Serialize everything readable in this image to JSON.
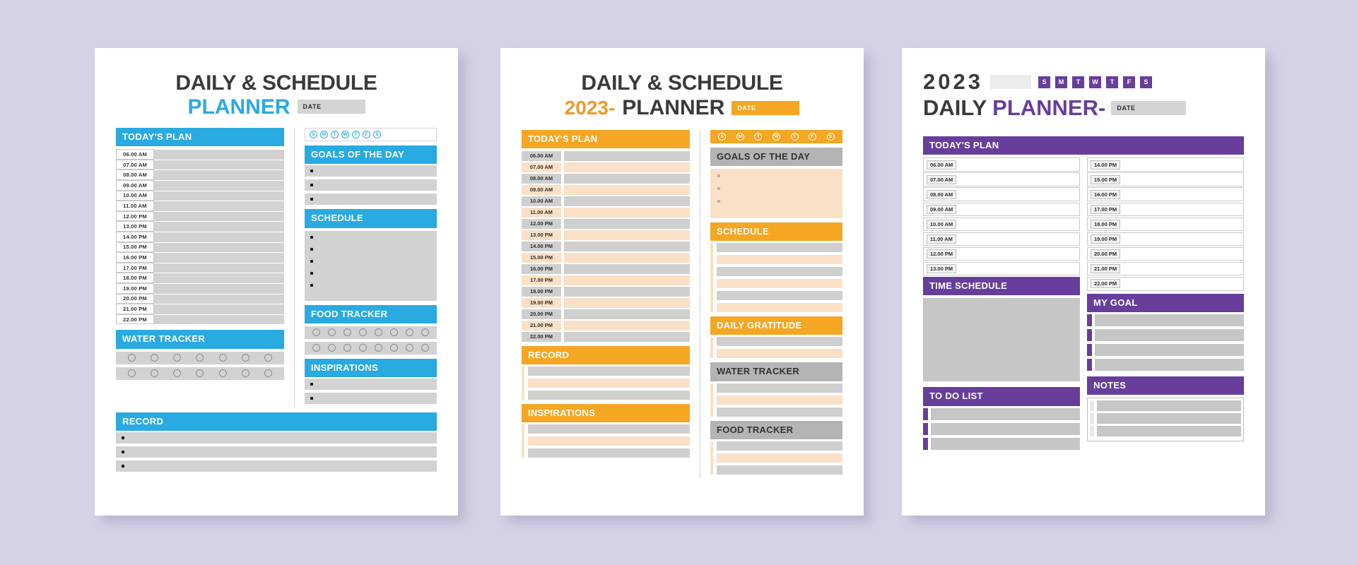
{
  "background_color": "#d5d2e8",
  "palette": {
    "blue": "#29aae1",
    "orange": "#f5a623",
    "purple": "#673e9b",
    "grey_bar": "#b4b4b4",
    "fill_grey": "#d2d2d2",
    "fill_peach": "#fae0c6"
  },
  "card1": {
    "title_line1": "DAILY & SCHEDULE",
    "title_line2": "PLANNER",
    "date_label": "DATE",
    "days": [
      "S",
      "M",
      "T",
      "W",
      "T",
      "F",
      "S"
    ],
    "todays_plan_label": "TODAY'S PLAN",
    "times": [
      "06.00 AM",
      "07.00 AM",
      "08.00 AM",
      "09.00 AM",
      "10.00 AM",
      "11.00 AM",
      "12.00 PM",
      "13.00 PM",
      "14.00 PM",
      "15.00 PM",
      "16.00 PM",
      "17.00 PM",
      "18.00 PM",
      "19.00 PM",
      "20.00 PM",
      "21.00 PM",
      "22.00 PM"
    ],
    "goals_label": "GOALS OF THE DAY",
    "goals_rows": 3,
    "schedule_label": "SCHEDULE",
    "schedule_rows": 5,
    "food_tracker_label": "FOOD TRACKER",
    "food_tracker_rows": 2,
    "food_tracker_circles_per_row": 8,
    "water_tracker_label": "WATER TRACKER",
    "water_tracker_rows": 2,
    "water_tracker_circles_per_row": 7,
    "inspirations_label": "INSPIRATIONS",
    "inspirations_rows": 2,
    "record_label": "RECORD",
    "record_rows": 3
  },
  "card2": {
    "title_line1": "DAILY & SCHEDULE",
    "title_year": "2023-",
    "title_line2": "PLANNER",
    "date_label": "DATE",
    "days": [
      "S",
      "M",
      "T",
      "W",
      "T",
      "F",
      "S"
    ],
    "todays_plan_label": "TODAY'S PLAN",
    "times": [
      "06.00 AM",
      "07.00 AM",
      "08.00 AM",
      "09.00 AM",
      "10.00 AM",
      "11.00 AM",
      "12.00 PM",
      "13.00 PM",
      "14.00 PM",
      "15.00 PM",
      "16.00 PM",
      "17.00 PM",
      "18.00 PM",
      "19.00 PM",
      "20.00 PM",
      "21.00 PM",
      "22.00 PM"
    ],
    "goals_label": "GOALS OF THE DAY",
    "goals_rows": 3,
    "schedule_label": "SCHEDULE",
    "schedule_rows": 6,
    "daily_gratitude_label": "DAILY GRATITUDE",
    "daily_gratitude_rows": 2,
    "water_tracker_label": "WATER TRACKER",
    "water_tracker_rows": 3,
    "food_tracker_label": "FOOD TRACKER",
    "food_tracker_rows": 3,
    "record_label": "RECORD",
    "record_rows": 3,
    "inspirations_label": "INSPIRATIONS",
    "inspirations_rows": 3
  },
  "card3": {
    "title_year": "2023",
    "title_daily": "DAILY",
    "title_planner": "PLANNER-",
    "date_label": "DATE",
    "days": [
      "S",
      "M",
      "T",
      "W",
      "T",
      "F",
      "S"
    ],
    "todays_plan_label": "TODAY'S PLAN",
    "times_left": [
      "06.00 AM",
      "07.00 AM",
      "08.00 AM",
      "09.00 AM",
      "10.00 AM",
      "11.00 AM",
      "12.00 PM",
      "13.00 PM"
    ],
    "times_right": [
      "14.00 PM",
      "15.00 PM",
      "16.00 PM",
      "17.00 PM",
      "18.00 PM",
      "19.00 PM",
      "20.00 PM",
      "21.00 PM",
      "22.00 PM"
    ],
    "time_schedule_label": "TIME SCHEDULE",
    "my_goal_label": "MY GOAL",
    "my_goal_rows": 4,
    "to_do_list_label": "TO DO LIST",
    "to_do_list_rows": 3,
    "notes_label": "NOTES",
    "notes_rows": 3
  }
}
